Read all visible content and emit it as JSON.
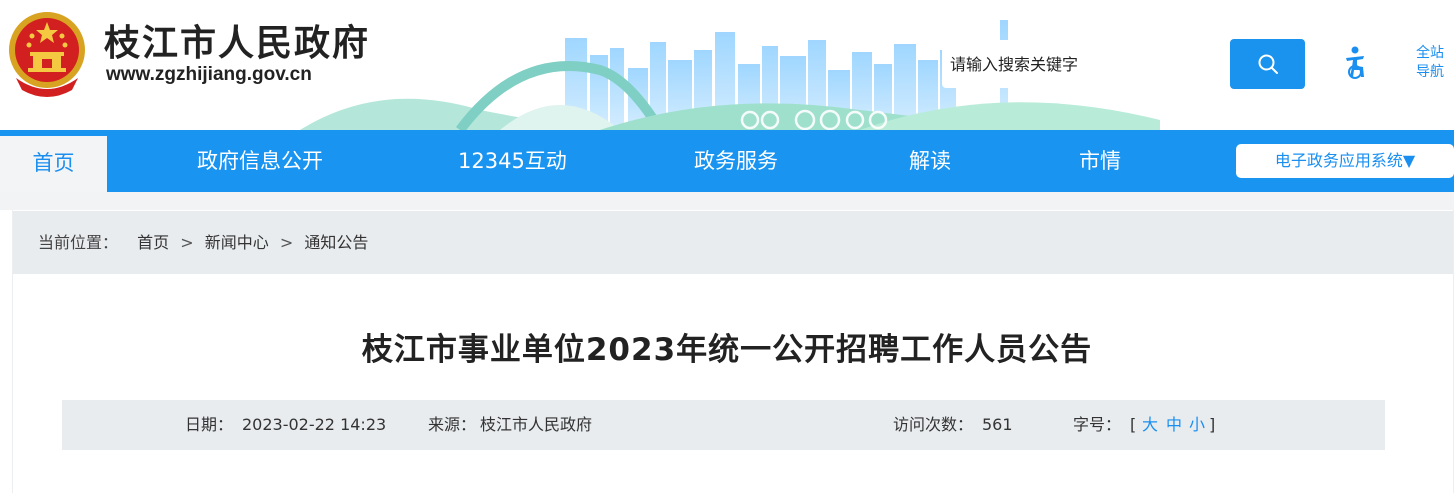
{
  "header": {
    "site_name": "枝江市人民政府",
    "site_url": "www.zgzhijiang.gov.cn",
    "emblem_icon": "national-emblem-icon",
    "search": {
      "placeholder": "请输入搜索关键字",
      "value": "",
      "button_icon": "search-icon"
    },
    "accessibility_icon": "accessibility-icon",
    "site_nav_line1": "全站",
    "site_nav_line2": "导航"
  },
  "nav": {
    "home": "首页",
    "items": [
      "政府信息公开",
      "12345互动",
      "政务服务",
      "解读",
      "市情"
    ],
    "egov_label": "电子政务应用系统▼"
  },
  "breadcrumb": {
    "label": "当前位置：",
    "items": [
      "首页",
      "新闻中心",
      "通知公告"
    ],
    "separator": ">"
  },
  "article": {
    "title": "枝江市事业单位2023年统一公开招聘工作人员公告",
    "date_label": "日期：",
    "date": "2023-02-22 14:23",
    "source_label": "来源：",
    "source": "枝江市人民政府",
    "visits_label": "访问次数：",
    "visits": "561",
    "font_label": "字号：",
    "font_open": "[",
    "font_large": "大",
    "font_medium": "中",
    "font_small": "小",
    "font_close": "]"
  },
  "colors": {
    "primary": "#1a94f1",
    "link": "#1a8ff0",
    "band": "#e9ecef"
  }
}
